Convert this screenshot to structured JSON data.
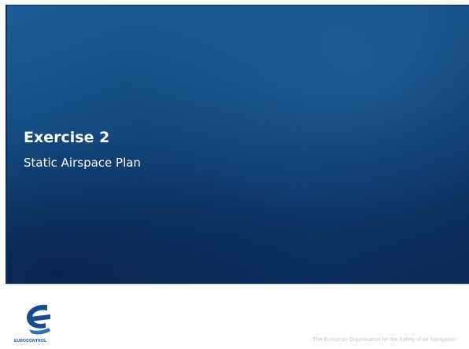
{
  "slide": {
    "title": "Exercise 2",
    "subtitle": "Static Airspace Plan",
    "tagline": "The European Organisation for the Safety of Air Navigation"
  },
  "logo": {
    "wordmark": "EUROCONTROL",
    "icon": "eurocontrol-logo-icon"
  },
  "colors": {
    "banner_top": "#1d5d97",
    "banner_bottom": "#0a2a55",
    "logo_blue": "#1a4b8c",
    "tagline_gray": "#c3c8d0"
  }
}
